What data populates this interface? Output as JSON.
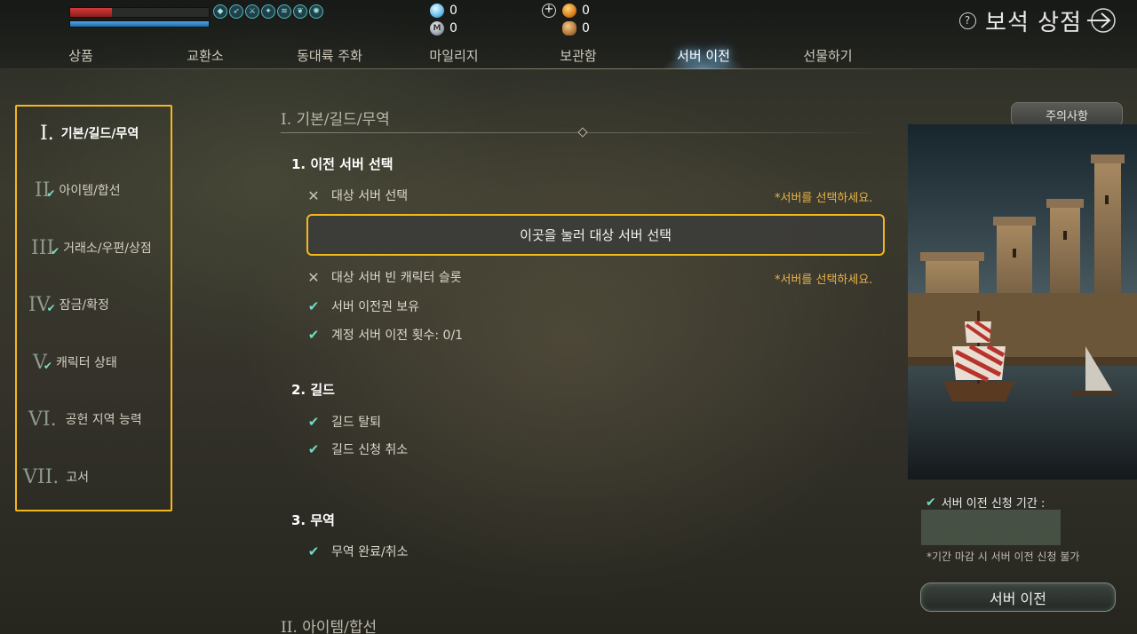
{
  "status": {
    "hp_fraction": 0.3,
    "mp_fraction": 1.0,
    "buff_icons": [
      "shield-buff-icon",
      "speed-buff-icon",
      "attack-buff-icon",
      "defense-buff-icon",
      "wind-buff-icon",
      "wing-buff-icon",
      "aura-buff-icon"
    ]
  },
  "currency": {
    "gem": "0",
    "mileage": "0",
    "gold": "0",
    "bread": "0",
    "mileage_symbol": "M",
    "plus_symbol": "+"
  },
  "header": {
    "help_symbol": "?",
    "title": "보석 상점"
  },
  "tabs": [
    {
      "label": "상품"
    },
    {
      "label": "교환소"
    },
    {
      "label": "동대륙 주화"
    },
    {
      "label": "마일리지"
    },
    {
      "label": "보관함"
    },
    {
      "label": "서버 이전",
      "active": true
    },
    {
      "label": "선물하기"
    }
  ],
  "sidebar": {
    "items": [
      {
        "roman": "I.",
        "label": "기본/길드/무역",
        "active": true,
        "checked": false
      },
      {
        "roman": "II",
        "label": "아이템/합선",
        "checked": true
      },
      {
        "roman": "III",
        "label": "거래소/우편/상점",
        "checked": true
      },
      {
        "roman": "IV",
        "label": "잠금/확정",
        "checked": true
      },
      {
        "roman": "V",
        "label": "캐릭터 상태",
        "checked": true
      },
      {
        "roman": "VI.",
        "label": "공헌 지역 능력",
        "checked": false
      },
      {
        "roman": "VII.",
        "label": "고서",
        "checked": false
      }
    ]
  },
  "main": {
    "section1_title": "I. 기본/길드/무역",
    "section2_title": "II. 아이템/합선",
    "sub1": {
      "title": "1. 이전 서버 선택",
      "rows": [
        {
          "mark": "✕",
          "text": "대상 서버 선택",
          "warn": "*서버를 선택하세요."
        },
        {
          "mark": "✕",
          "text": "대상 서버 빈 캐릭터 슬롯",
          "warn": "*서버를 선택하세요."
        },
        {
          "mark": "✔",
          "text": "서버 이전권 보유"
        },
        {
          "mark": "✔",
          "text": "계정 서버 이전 횟수: 0/1"
        }
      ],
      "select_button": "이곳을 눌러 대상 서버 선택"
    },
    "sub2": {
      "title": "2. 길드",
      "rows": [
        {
          "mark": "✔",
          "text": "길드 탈퇴"
        },
        {
          "mark": "✔",
          "text": "길드 신청 취소"
        }
      ]
    },
    "sub3": {
      "title": "3. 무역",
      "rows": [
        {
          "mark": "✔",
          "text": "무역 완료/취소"
        }
      ]
    }
  },
  "right_panel": {
    "notice_button": "주의사항",
    "period_check": "✔",
    "period_label": "서버 이전 신청 기간 :",
    "period_note": "*기간 마감 시 서버 이전 신청 불가",
    "transfer_button": "서버 이전"
  },
  "colors": {
    "highlight": "#f3b81c",
    "check": "#6fdcc3",
    "warning": "#e9b247"
  }
}
